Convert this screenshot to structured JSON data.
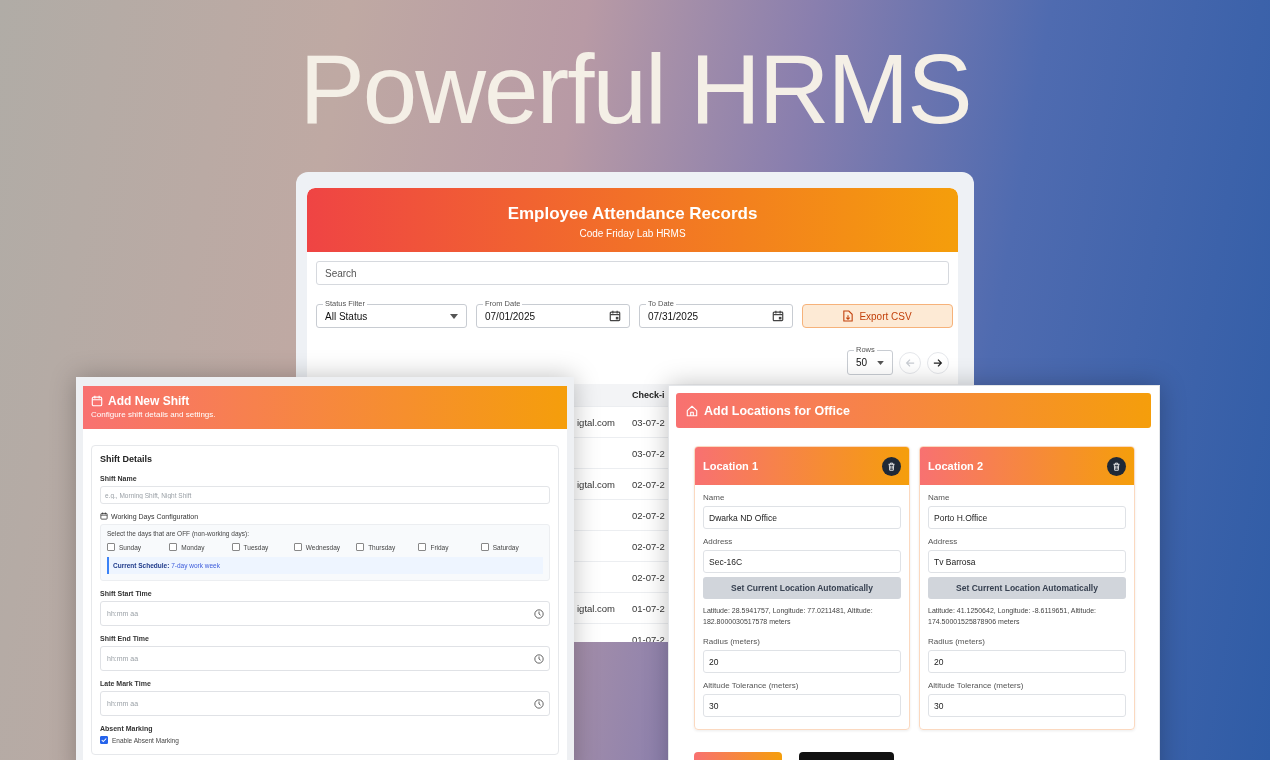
{
  "headline": "Powerful HRMS",
  "attendance": {
    "title": "Employee Attendance Records",
    "subtitle": "Code Friday Lab HRMS",
    "search": {
      "placeholder": "Search"
    },
    "filters": [
      {
        "kind": "select",
        "label": "Status Filter",
        "value": "All Status"
      },
      {
        "kind": "date",
        "label": "From Date",
        "value": "07/01/2025"
      },
      {
        "kind": "date",
        "label": "To Date",
        "value": "07/31/2025"
      }
    ],
    "export_button": "Export CSV",
    "rows_select": {
      "label": "Rows",
      "value": "50"
    },
    "pager": [
      {
        "kind": "prev",
        "disabled": true
      },
      {
        "kind": "next",
        "disabled": false
      }
    ],
    "table": {
      "columns": [
        {
          "label": "Check-i"
        }
      ],
      "rows": [
        {
          "column_1": "igtal.com",
          "check_in": "03-07-2"
        },
        {
          "column_1": "",
          "check_in": "03-07-2"
        },
        {
          "column_1": "igtal.com",
          "check_in": "02-07-2"
        },
        {
          "column_1": "",
          "check_in": "02-07-2"
        },
        {
          "column_1": "",
          "check_in": "02-07-2"
        },
        {
          "column_1": "",
          "check_in": "02-07-2"
        },
        {
          "column_1": "igtal.com",
          "check_in": "01-07-2"
        },
        {
          "column_1": "",
          "check_in": "01-07-2"
        }
      ]
    }
  },
  "shift": {
    "title": "Add New Shift",
    "subtitle": "Configure shift details and settings.",
    "section_title": "Shift Details",
    "name_field": {
      "label": "Shift Name",
      "placeholder": "e.g., Morning Shift, Night Shift"
    },
    "working_days": {
      "title": "Working Days Configuration",
      "instruction": "Select the days that are OFF (non-working days):",
      "days": [
        {
          "label": "Sunday",
          "checked": false
        },
        {
          "label": "Monday",
          "checked": false
        },
        {
          "label": "Tuesday",
          "checked": false
        },
        {
          "label": "Wednesday",
          "checked": false
        },
        {
          "label": "Thursday",
          "checked": false
        },
        {
          "label": "Friday",
          "checked": false
        },
        {
          "label": "Saturday",
          "checked": false
        }
      ],
      "schedule": "**Current Schedule:** 7-day work week"
    },
    "time_fields": [
      {
        "label": "Shift Start Time",
        "placeholder": "hh:mm aa"
      },
      {
        "label": "Shift End Time",
        "placeholder": "hh:mm aa"
      },
      {
        "label": "Late Mark Time",
        "placeholder": "hh:mm aa"
      }
    ],
    "absent": {
      "title": "Absent Marking",
      "option": {
        "label": "Enable Absent Marking",
        "checked": true
      }
    }
  },
  "locations": {
    "title": "Add Locations for Office",
    "cards": [
      {
        "title": "Location 1",
        "fields_top": [
          {
            "label": "Name",
            "value": "Dwarka ND Office"
          },
          {
            "label": "Address",
            "value": "Sec-16C"
          }
        ],
        "auto_button": "Set Current Location Automatically",
        "coordinates": "Latitude: 28.5941757, Longitude: 77.0211481, Altitude: 182.8000030517578 meters",
        "fields_bottom": [
          {
            "label": "Radius (meters)",
            "value": "20"
          },
          {
            "label": "Altitude Tolerance (meters)",
            "value": "30"
          }
        ]
      },
      {
        "title": "Location 2",
        "fields_top": [
          {
            "label": "Name",
            "value": "Porto H.Office"
          },
          {
            "label": "Address",
            "value": "Tv Barrosa"
          }
        ],
        "auto_button": "Set Current Location Automatically",
        "coordinates": "Latitude: 41.1250642, Longitude: -8.6119651, Altitude: 174.50001525878906 meters",
        "fields_bottom": [
          {
            "label": "Radius (meters)",
            "value": "20"
          },
          {
            "label": "Altitude Tolerance (meters)",
            "value": "30"
          }
        ]
      }
    ],
    "bottom_buttons": [
      {
        "kind": "primary"
      },
      {
        "kind": "dark"
      }
    ]
  }
}
